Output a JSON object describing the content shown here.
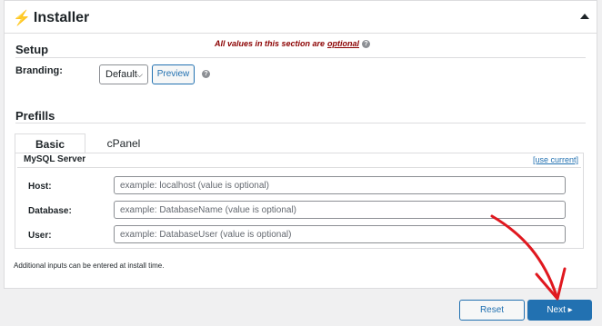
{
  "installer": {
    "title": "Installer",
    "title_icon": "lightning-bolt-icon",
    "toggle_icon": "collapse-triangle-icon"
  },
  "setup": {
    "title": "Setup",
    "optional_note_prefix": "All values in this section are ",
    "optional_note_link": "optional",
    "help_glyph": "?",
    "branding_label": "Branding:",
    "branding_value": "Default",
    "preview_label": "Preview"
  },
  "prefills": {
    "title": "Prefills",
    "tabs": [
      {
        "label": "Basic",
        "active": true
      },
      {
        "label": "cPanel",
        "active": false
      }
    ],
    "mysql": {
      "title": "MySQL Server",
      "use_current": "[use current]",
      "fields": [
        {
          "label": "Host:",
          "placeholder": "example: localhost (value is optional)",
          "value": ""
        },
        {
          "label": "Database:",
          "placeholder": "example: DatabaseName (value is optional)",
          "value": ""
        },
        {
          "label": "User:",
          "placeholder": "example: DatabaseUser (value is optional)",
          "value": ""
        }
      ]
    },
    "note": "Additional inputs can be entered at install time."
  },
  "footer": {
    "reset_label": "Reset",
    "next_label": "Next ▸"
  },
  "colors": {
    "accent": "#2271b1",
    "optional_note": "#8b0000",
    "annotation_arrow": "#e0181f"
  }
}
